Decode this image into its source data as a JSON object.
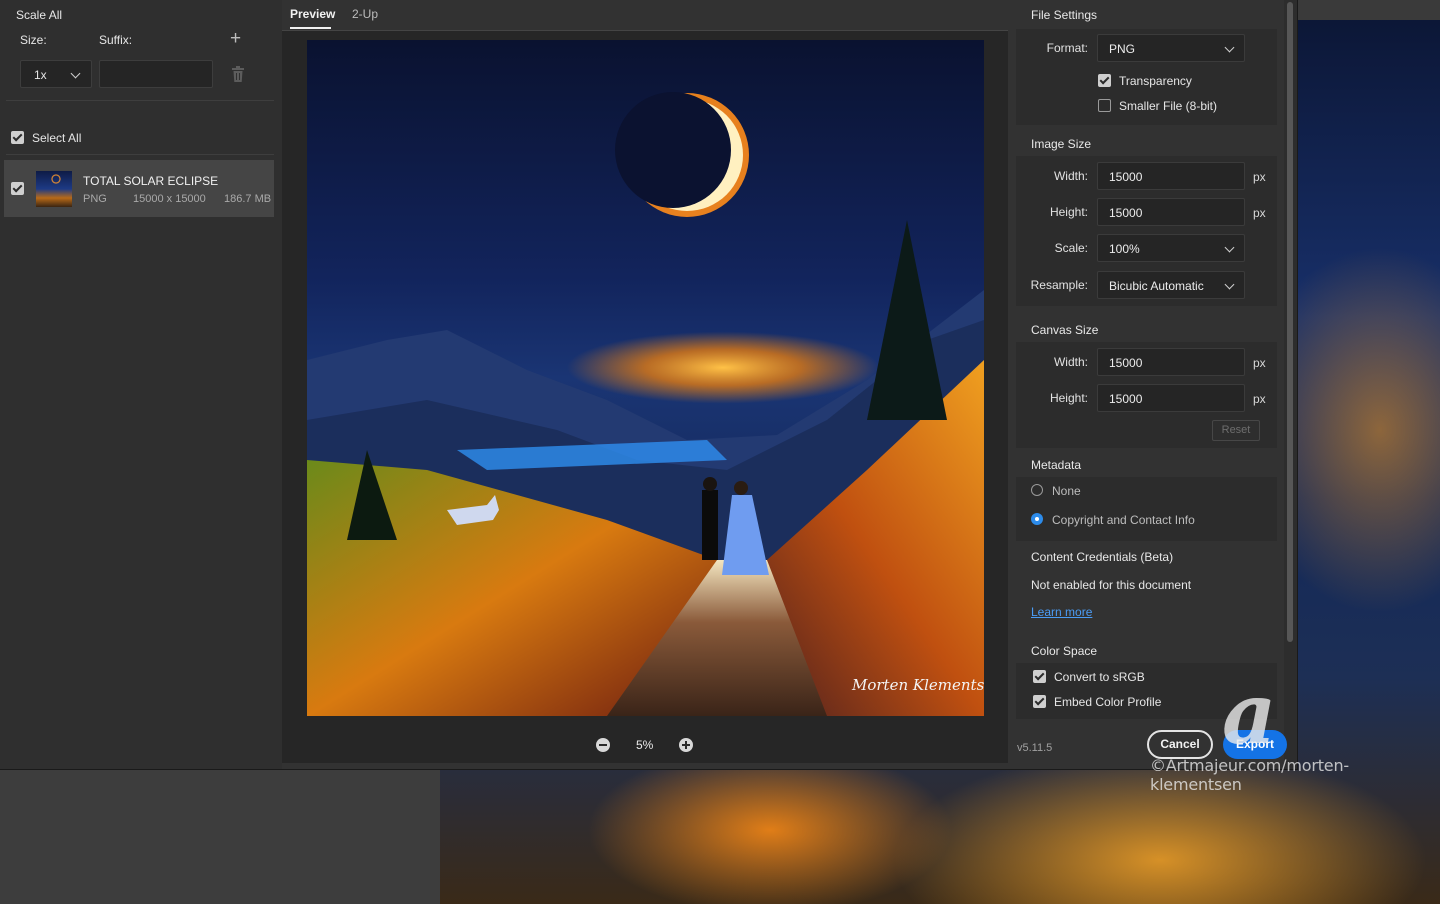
{
  "left_panel": {
    "title": "Scale All",
    "size_label": "Size:",
    "suffix_label": "Suffix:",
    "scale_value": "1x",
    "suffix_value": "",
    "select_all_label": "Select All",
    "asset": {
      "name": "TOTAL SOLAR ECLIPSE",
      "type": "PNG",
      "dimensions": "15000 x 15000",
      "size": "186.7 MB"
    }
  },
  "tabs": [
    {
      "label": "Preview"
    },
    {
      "label": "2-Up"
    }
  ],
  "preview": {
    "zoom": "5%",
    "signature": "Morten Klementsen"
  },
  "file_settings": {
    "title": "File Settings",
    "format_label": "Format:",
    "format_value": "PNG",
    "transparency_label": "Transparency",
    "smaller_file_label": "Smaller File (8-bit)"
  },
  "image_size": {
    "title": "Image Size",
    "width_label": "Width:",
    "width_value": "15000",
    "height_label": "Height:",
    "height_value": "15000",
    "unit": "px",
    "scale_label": "Scale:",
    "scale_value": "100%",
    "resample_label": "Resample:",
    "resample_value": "Bicubic Automatic"
  },
  "canvas_size": {
    "title": "Canvas Size",
    "width_label": "Width:",
    "width_value": "15000",
    "height_label": "Height:",
    "height_value": "15000",
    "unit": "px",
    "reset_label": "Reset"
  },
  "metadata": {
    "title": "Metadata",
    "none_label": "None",
    "copyright_label": "Copyright and Contact Info"
  },
  "content_credentials": {
    "title": "Content Credentials (Beta)",
    "status": "Not enabled for this document",
    "link": "Learn more"
  },
  "color_space": {
    "title": "Color Space",
    "convert_label": "Convert to sRGB",
    "embed_label": "Embed Color Profile"
  },
  "footer": {
    "version": "v5.11.5",
    "cancel_label": "Cancel",
    "export_label": "Export"
  },
  "watermark": {
    "text": "©Artmajeur.com/morten-klementsen"
  },
  "colors": {
    "accent": "#1473e6",
    "link": "#4b9cf5",
    "radio_selected": "#2d8ceb"
  }
}
